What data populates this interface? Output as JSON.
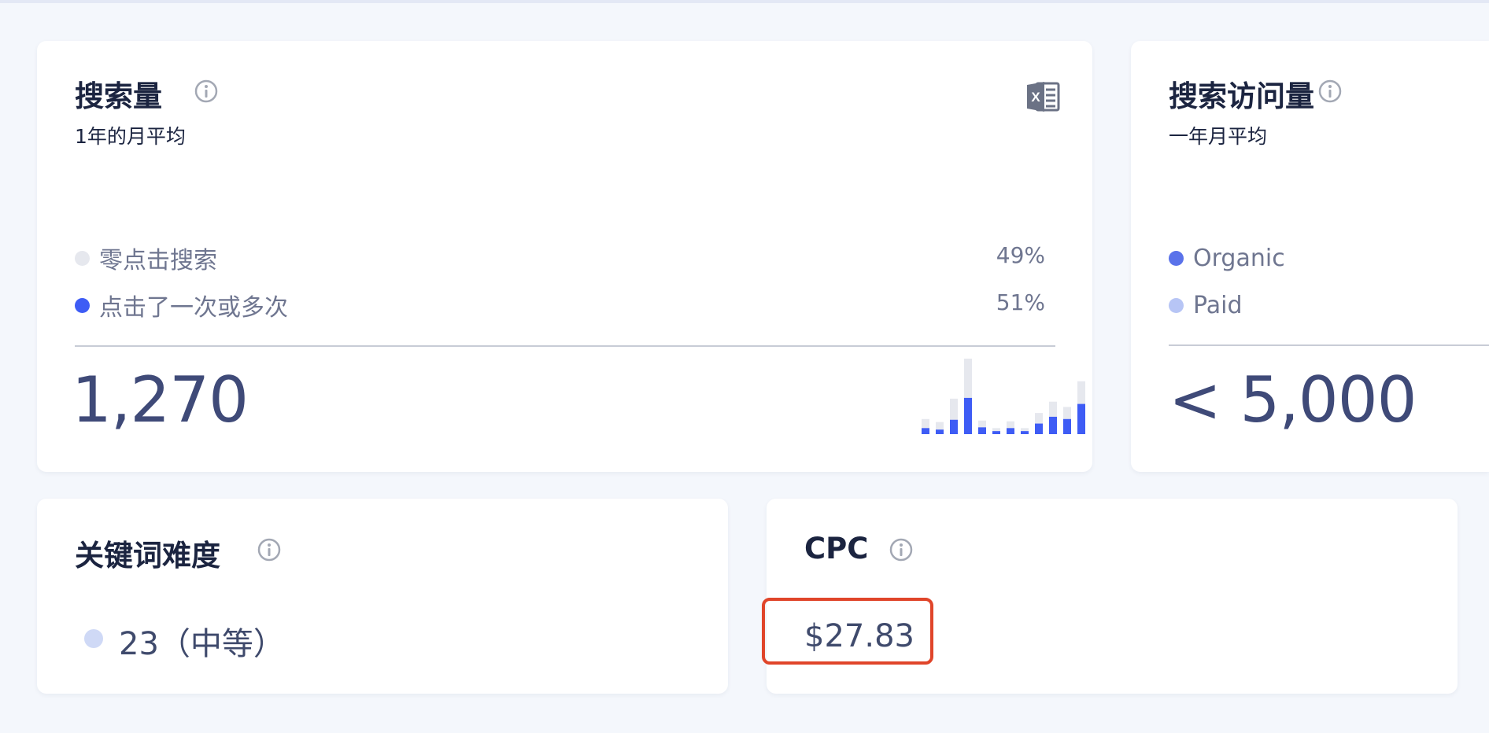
{
  "search_volume": {
    "title": "搜索量",
    "subtitle": "1年的月平均",
    "export_icon": "excel-icon",
    "legend": [
      {
        "label": "零点击搜索",
        "pct": "49%",
        "color": "#e6e8ee"
      },
      {
        "label": "点击了一次或多次",
        "pct": "51%",
        "color": "#3e5cf5"
      }
    ],
    "value": "1,270",
    "monthly_trend": [
      {
        "total": 20,
        "clicked": 8
      },
      {
        "total": 16,
        "clicked": 6
      },
      {
        "total": 47,
        "clicked": 19
      },
      {
        "total": 100,
        "clicked": 48
      },
      {
        "total": 18,
        "clicked": 9
      },
      {
        "total": 8,
        "clicked": 4
      },
      {
        "total": 17,
        "clicked": 8
      },
      {
        "total": 8,
        "clicked": 4
      },
      {
        "total": 28,
        "clicked": 14
      },
      {
        "total": 43,
        "clicked": 23
      },
      {
        "total": 36,
        "clicked": 20
      },
      {
        "total": 70,
        "clicked": 40
      }
    ]
  },
  "search_traffic": {
    "title": "搜索访问量",
    "subtitle": "一年月平均",
    "legend": [
      {
        "label": "Organic",
        "color": "#5a72ea"
      },
      {
        "label": "Paid",
        "color": "#b7c5f5"
      }
    ],
    "value": "< 5,000"
  },
  "keyword_difficulty": {
    "title": "关键词难度",
    "dot_color": "#cfd9f6",
    "value": "23（中等）"
  },
  "cpc": {
    "title": "CPC",
    "value": "$27.83",
    "highlight_color": "#e0452a"
  }
}
